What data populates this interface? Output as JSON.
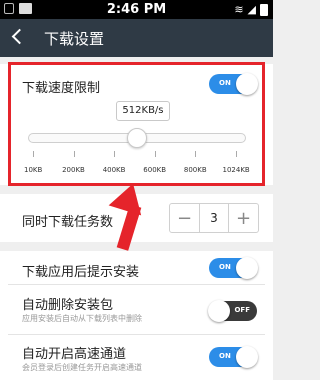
{
  "status_bar": {
    "time": "2:46 PM"
  },
  "header": {
    "title": "下载设置"
  },
  "speed_limit": {
    "label": "下载速度限制",
    "toggle_text": "ON",
    "enabled": true,
    "value_label": "512KB/s",
    "value_kbps": 512,
    "ticks": [
      "10KB",
      "200KB",
      "400KB",
      "600KB",
      "800KB",
      "1024KB"
    ]
  },
  "concurrent": {
    "label": "同时下载任务数",
    "value": "3",
    "minus": "−",
    "plus": "+"
  },
  "install_prompt": {
    "label": "下载应用后提示安装",
    "toggle_text": "ON",
    "enabled": true
  },
  "auto_delete": {
    "label": "自动删除安装包",
    "description": "应用安装后自动从下载列表中删除",
    "toggle_text": "OFF",
    "enabled": false
  },
  "high_speed": {
    "label": "自动开启高速通道",
    "description": "会员登录后创建任务开启高速通道",
    "toggle_text": "ON",
    "enabled": true
  },
  "colors": {
    "accent": "#2c8de8",
    "highlight": "#e5242b",
    "header": "#2f3a45"
  }
}
